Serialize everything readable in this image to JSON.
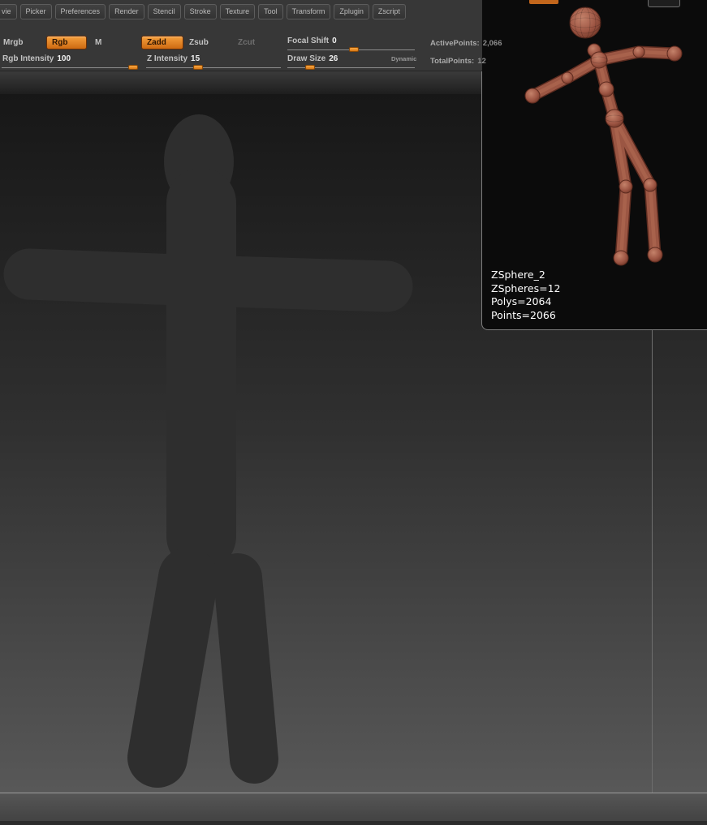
{
  "menu": {
    "items": [
      "vie",
      "Picker",
      "Preferences",
      "Render",
      "Stencil",
      "Stroke",
      "Texture",
      "Tool",
      "Transform",
      "Zplugin",
      "Zscript"
    ]
  },
  "toolbar": {
    "mrgb_label": "Mrgb",
    "rgb_label": "Rgb",
    "m_label": "M",
    "zadd_label": "Zadd",
    "zsub_label": "Zsub",
    "zcut_label": "Zcut",
    "focal_shift_label": "Focal Shift",
    "focal_shift_value": "0",
    "draw_size_label": "Draw Size",
    "draw_size_value": "26",
    "dynamic_label": "Dynamic",
    "rgb_intensity_label": "Rgb Intensity",
    "rgb_intensity_value": "100",
    "z_intensity_label": "Z Intensity",
    "z_intensity_value": "15",
    "active_points_label": "ActivePoints:",
    "active_points_value": "2,066",
    "total_points_label": "TotalPoints:",
    "total_points_value": "12"
  },
  "preview": {
    "info": [
      "ZSphere_2",
      "ZSpheres=12",
      "Polys=2064",
      "Points=2066"
    ]
  },
  "colors": {
    "accent_orange": "#e8882c",
    "model_red": "#9b5643",
    "canvas_top": "#171717",
    "canvas_bottom": "#575757"
  }
}
